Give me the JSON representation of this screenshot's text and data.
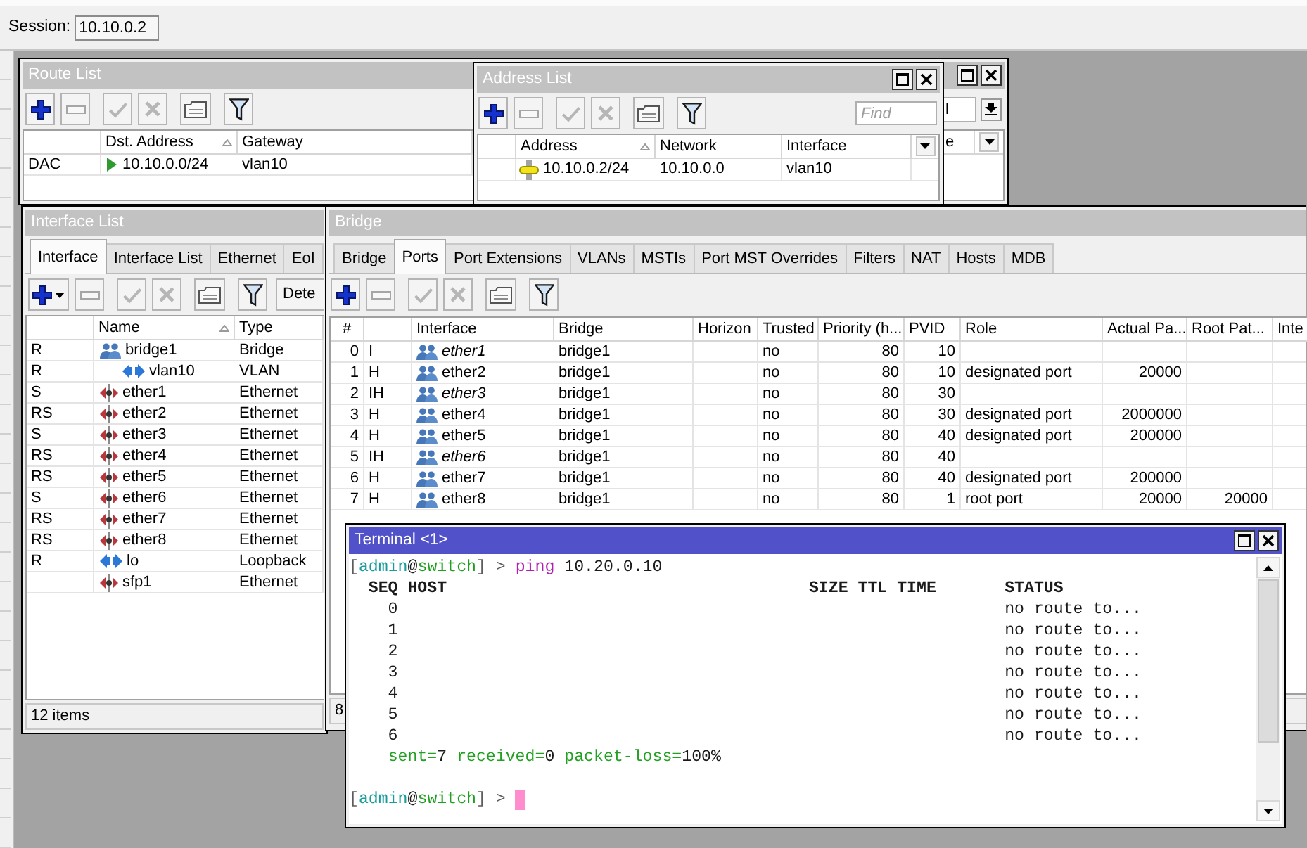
{
  "session": {
    "label": "Session:",
    "value": "10.10.0.2"
  },
  "route_list": {
    "title": "Route List",
    "focused": false,
    "filter_value": "l",
    "columns": [
      {
        "label": "Dst. Address",
        "sorted": true
      },
      {
        "label": "Gateway",
        "sorted": false
      },
      {
        "label": "e",
        "sorted": false
      }
    ],
    "rows": [
      {
        "flags": "DAC",
        "dst_address": "10.10.0.0/24",
        "gateway": "vlan10"
      }
    ]
  },
  "address_list": {
    "title": "Address List",
    "focused": false,
    "find_placeholder": "Find",
    "columns": [
      {
        "label": "Address",
        "sorted": true
      },
      {
        "label": "Network",
        "sorted": false
      },
      {
        "label": "Interface",
        "sorted": false
      }
    ],
    "rows": [
      {
        "address": "10.10.0.2/24",
        "network": "10.10.0.0",
        "interface": "vlan10"
      }
    ]
  },
  "interface_list": {
    "title": "Interface List",
    "focused": false,
    "tabs": [
      {
        "label": "Interface",
        "selected": true
      },
      {
        "label": "Interface List",
        "selected": false
      },
      {
        "label": "Ethernet",
        "selected": false
      },
      {
        "label": "EoI",
        "selected": false
      }
    ],
    "detect_button": "Dete",
    "columns": [
      {
        "label": "Name",
        "sorted": true
      },
      {
        "label": "Type",
        "sorted": false
      }
    ],
    "rows": [
      {
        "flags": "R",
        "name": "bridge1",
        "kind": "bridge",
        "type": "Bridge",
        "children": [
          {
            "flags": "R",
            "name": "vlan10",
            "kind": "vlan",
            "type": "VLAN"
          }
        ]
      },
      {
        "flags": "S",
        "name": "ether1",
        "kind": "ethernet",
        "type": "Ethernet"
      },
      {
        "flags": "RS",
        "name": "ether2",
        "kind": "ethernet",
        "type": "Ethernet"
      },
      {
        "flags": "S",
        "name": "ether3",
        "kind": "ethernet",
        "type": "Ethernet"
      },
      {
        "flags": "RS",
        "name": "ether4",
        "kind": "ethernet",
        "type": "Ethernet"
      },
      {
        "flags": "RS",
        "name": "ether5",
        "kind": "ethernet",
        "type": "Ethernet"
      },
      {
        "flags": "S",
        "name": "ether6",
        "kind": "ethernet",
        "type": "Ethernet"
      },
      {
        "flags": "RS",
        "name": "ether7",
        "kind": "ethernet",
        "type": "Ethernet"
      },
      {
        "flags": "RS",
        "name": "ether8",
        "kind": "ethernet",
        "type": "Ethernet"
      },
      {
        "flags": "R",
        "name": "lo",
        "kind": "loopback",
        "type": "Loopback"
      },
      {
        "name": "sfp1",
        "kind": "ethernet",
        "type": "Ethernet"
      }
    ],
    "status": "12 items"
  },
  "bridge": {
    "title": "Bridge",
    "focused": false,
    "tabs": [
      {
        "label": "Bridge",
        "selected": false
      },
      {
        "label": "Ports",
        "selected": true
      },
      {
        "label": "Port Extensions",
        "selected": false
      },
      {
        "label": "VLANs",
        "selected": false
      },
      {
        "label": "MSTIs",
        "selected": false
      },
      {
        "label": "Port MST Overrides",
        "selected": false
      },
      {
        "label": "Filters",
        "selected": false
      },
      {
        "label": "NAT",
        "selected": false
      },
      {
        "label": "Hosts",
        "selected": false
      },
      {
        "label": "MDB",
        "selected": false
      }
    ],
    "columns": [
      "#",
      "Interface",
      "Bridge",
      "Horizon",
      "Trusted",
      "Priority (h...",
      "PVID",
      "Role",
      "Actual Pa...",
      "Root Pat...",
      "Inte"
    ],
    "rows": [
      {
        "num": "0",
        "flags": "I",
        "interface": "ether1",
        "inactive": true,
        "bridge": "bridge1",
        "trusted": "no",
        "priority": "80",
        "pvid": "10"
      },
      {
        "num": "1",
        "flags": "H",
        "interface": "ether2",
        "inactive": false,
        "bridge": "bridge1",
        "trusted": "no",
        "priority": "80",
        "pvid": "10",
        "role": "designated port",
        "column_9": "20000"
      },
      {
        "num": "2",
        "flags": "IH",
        "interface": "ether3",
        "inactive": true,
        "bridge": "bridge1",
        "trusted": "no",
        "priority": "80",
        "pvid": "30"
      },
      {
        "num": "3",
        "flags": "H",
        "interface": "ether4",
        "inactive": false,
        "bridge": "bridge1",
        "trusted": "no",
        "priority": "80",
        "pvid": "30",
        "role": "designated port",
        "column_9": "2000000"
      },
      {
        "num": "4",
        "flags": "H",
        "interface": "ether5",
        "inactive": false,
        "bridge": "bridge1",
        "trusted": "no",
        "priority": "80",
        "pvid": "40",
        "role": "designated port",
        "column_9": "200000"
      },
      {
        "num": "5",
        "flags": "IH",
        "interface": "ether6",
        "inactive": true,
        "bridge": "bridge1",
        "trusted": "no",
        "priority": "80",
        "pvid": "40"
      },
      {
        "num": "6",
        "flags": "H",
        "interface": "ether7",
        "inactive": false,
        "bridge": "bridge1",
        "trusted": "no",
        "priority": "80",
        "pvid": "40",
        "role": "designated port",
        "column_9": "200000"
      },
      {
        "num": "7",
        "flags": "H",
        "interface": "ether8",
        "inactive": false,
        "bridge": "bridge1",
        "trusted": "no",
        "priority": "80",
        "pvid": "1",
        "role": "root port",
        "column_9": "20000",
        "column_10": "20000"
      }
    ],
    "status": "8"
  },
  "terminal": {
    "title": "Terminal <1>",
    "focused": true,
    "command_line": [
      {
        "text": "[",
        "kind": "punct"
      },
      {
        "text": "admin",
        "kind": "user"
      },
      {
        "text": "@",
        "kind": "plain"
      },
      {
        "text": "switch",
        "kind": "host"
      },
      {
        "text": "] > ",
        "kind": "punct"
      },
      {
        "text": "ping",
        "kind": "command"
      },
      {
        "text": " 10.20.0.10",
        "kind": "plain"
      }
    ],
    "ping_columns": [
      "SEQ",
      "HOST",
      "SIZE",
      "TTL",
      "TIME",
      "STATUS"
    ],
    "ping_rows": [
      {
        "seq": "0",
        "status": "no route to..."
      },
      {
        "seq": "1",
        "status": "no route to..."
      },
      {
        "seq": "2",
        "status": "no route to..."
      },
      {
        "seq": "3",
        "status": "no route to..."
      },
      {
        "seq": "4",
        "status": "no route to..."
      },
      {
        "seq": "5",
        "status": "no route to..."
      },
      {
        "seq": "6",
        "status": "no route to..."
      }
    ],
    "summary": [
      {
        "key": "sent=",
        "value": "7"
      },
      {
        "key": "received=",
        "value": "0"
      },
      {
        "key": "packet-loss=",
        "value": "100%"
      }
    ],
    "prompt": [
      {
        "text": "[",
        "kind": "punct"
      },
      {
        "text": "admin",
        "kind": "user"
      },
      {
        "text": "@",
        "kind": "plain"
      },
      {
        "text": "switch",
        "kind": "host"
      },
      {
        "text": "] >",
        "kind": "punct"
      }
    ],
    "cursor": true
  }
}
